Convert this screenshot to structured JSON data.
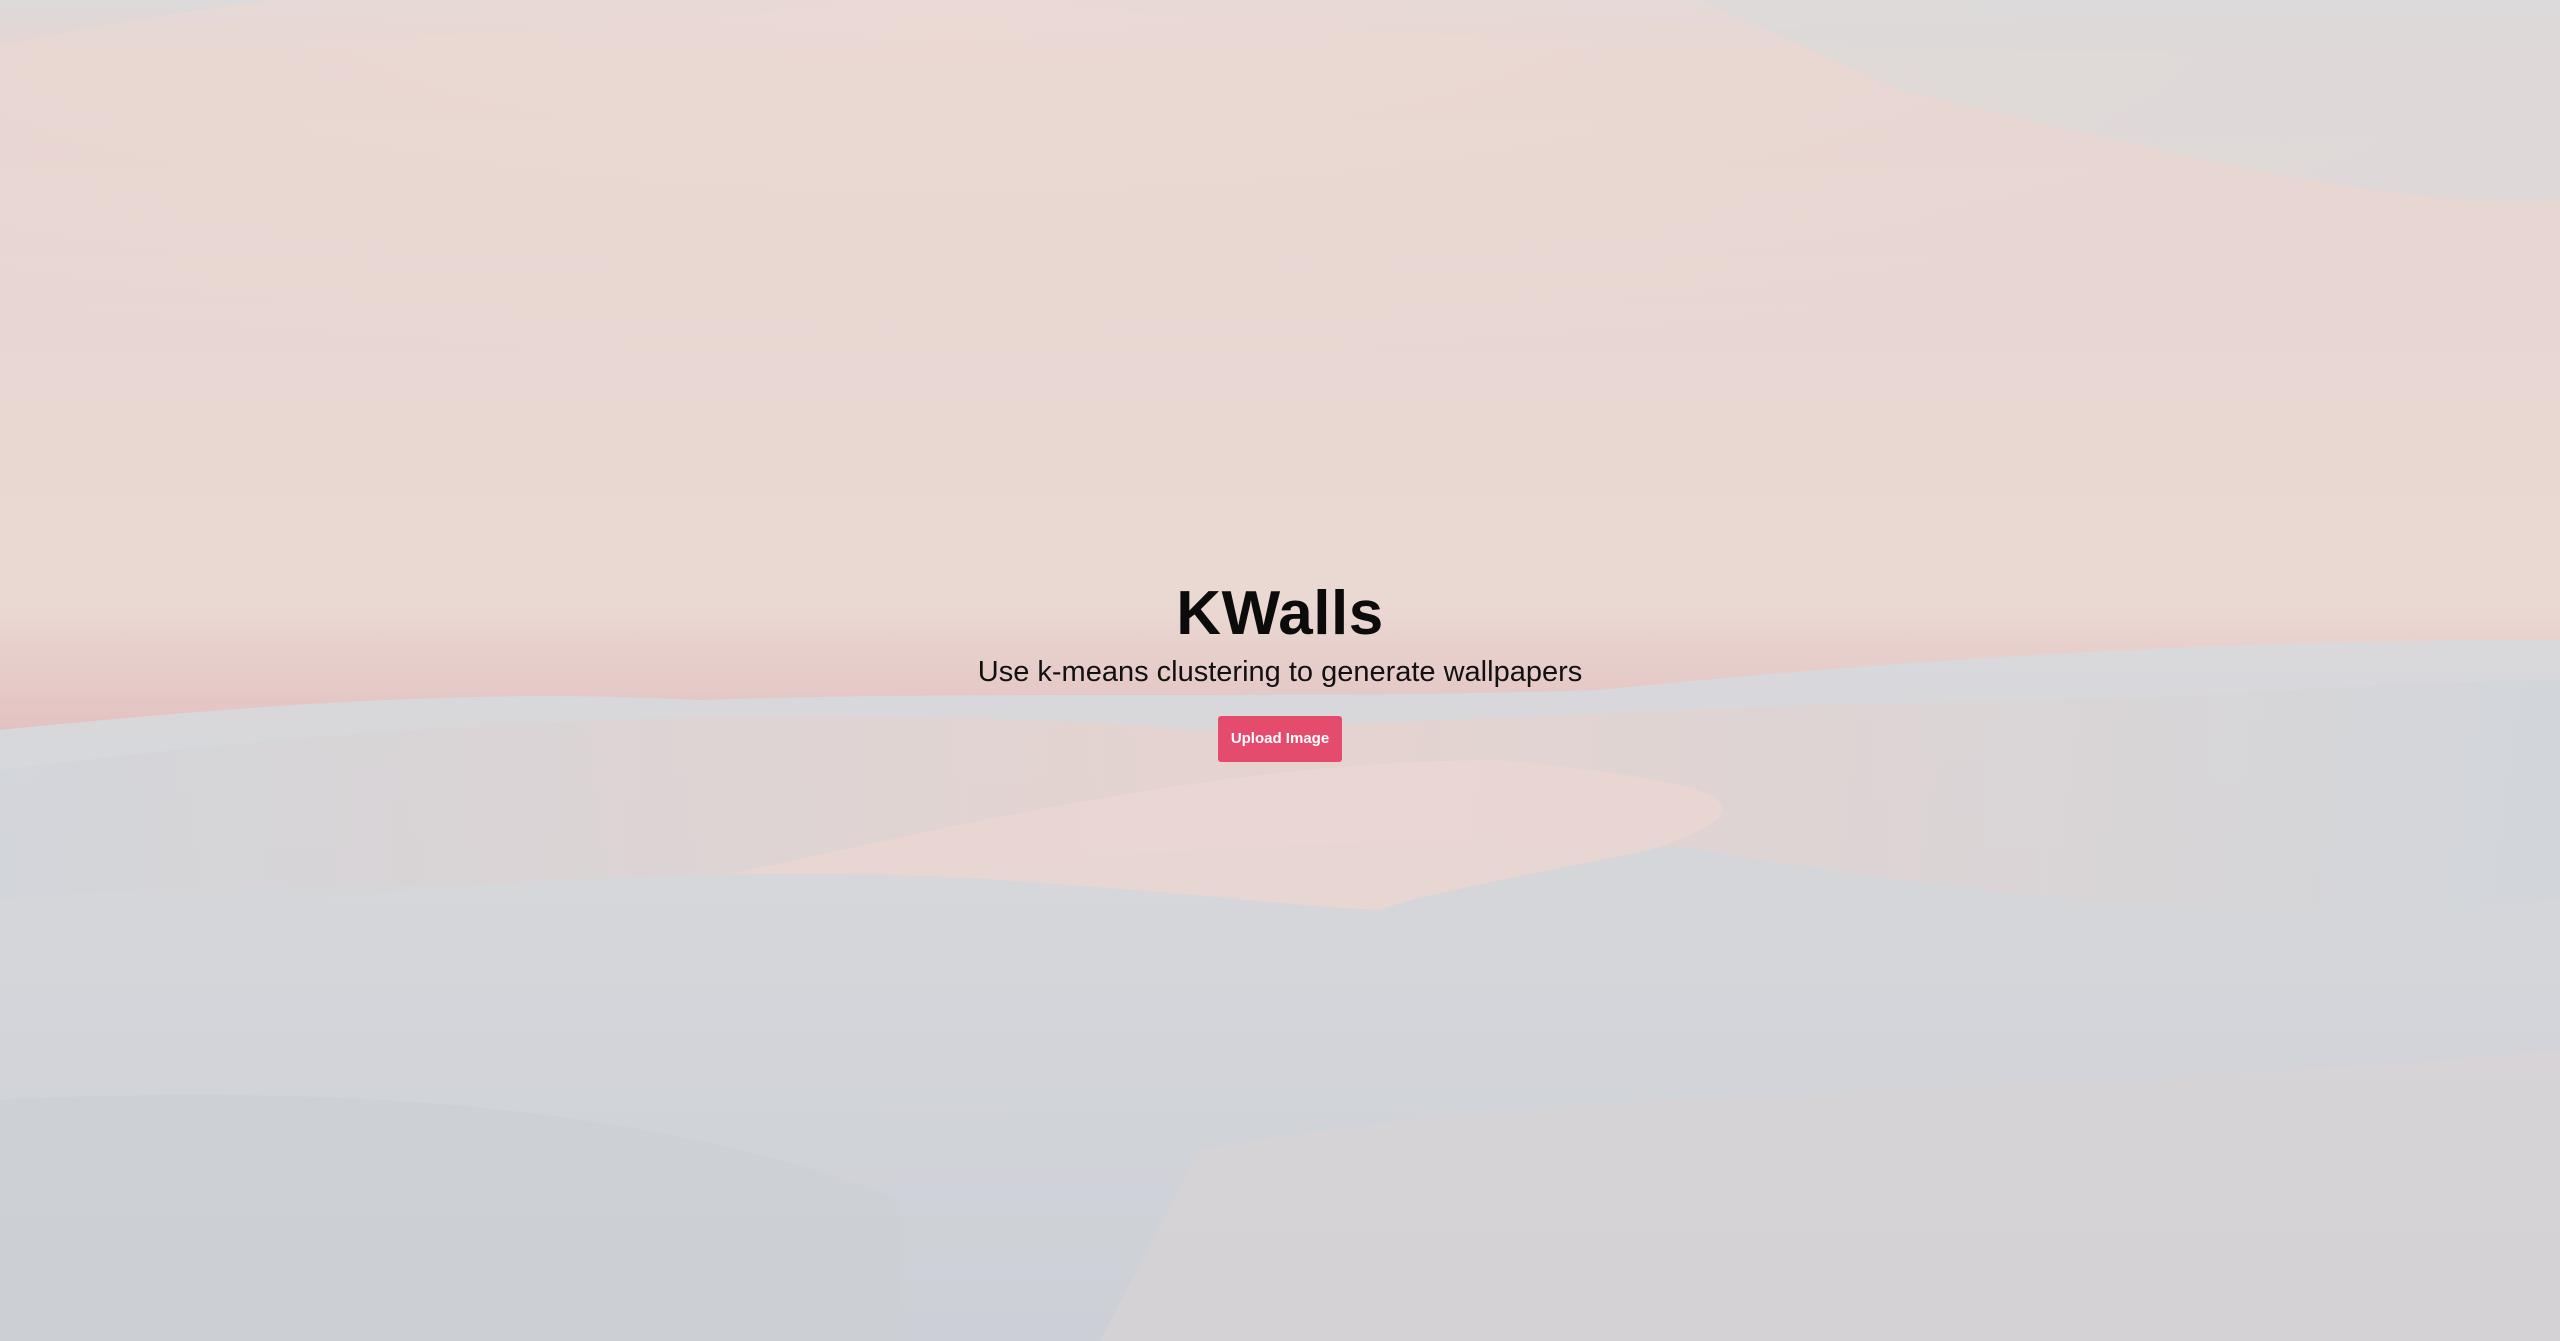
{
  "hero": {
    "title": "KWalls",
    "subtitle": "Use k-means clustering to generate wallpapers",
    "upload_label": "Upload Image"
  },
  "colors": {
    "accent": "#e54b6d",
    "background_sky": "#ead7d2",
    "background_band": "#e0bcbc",
    "background_dunes": "#cfd3d8"
  }
}
